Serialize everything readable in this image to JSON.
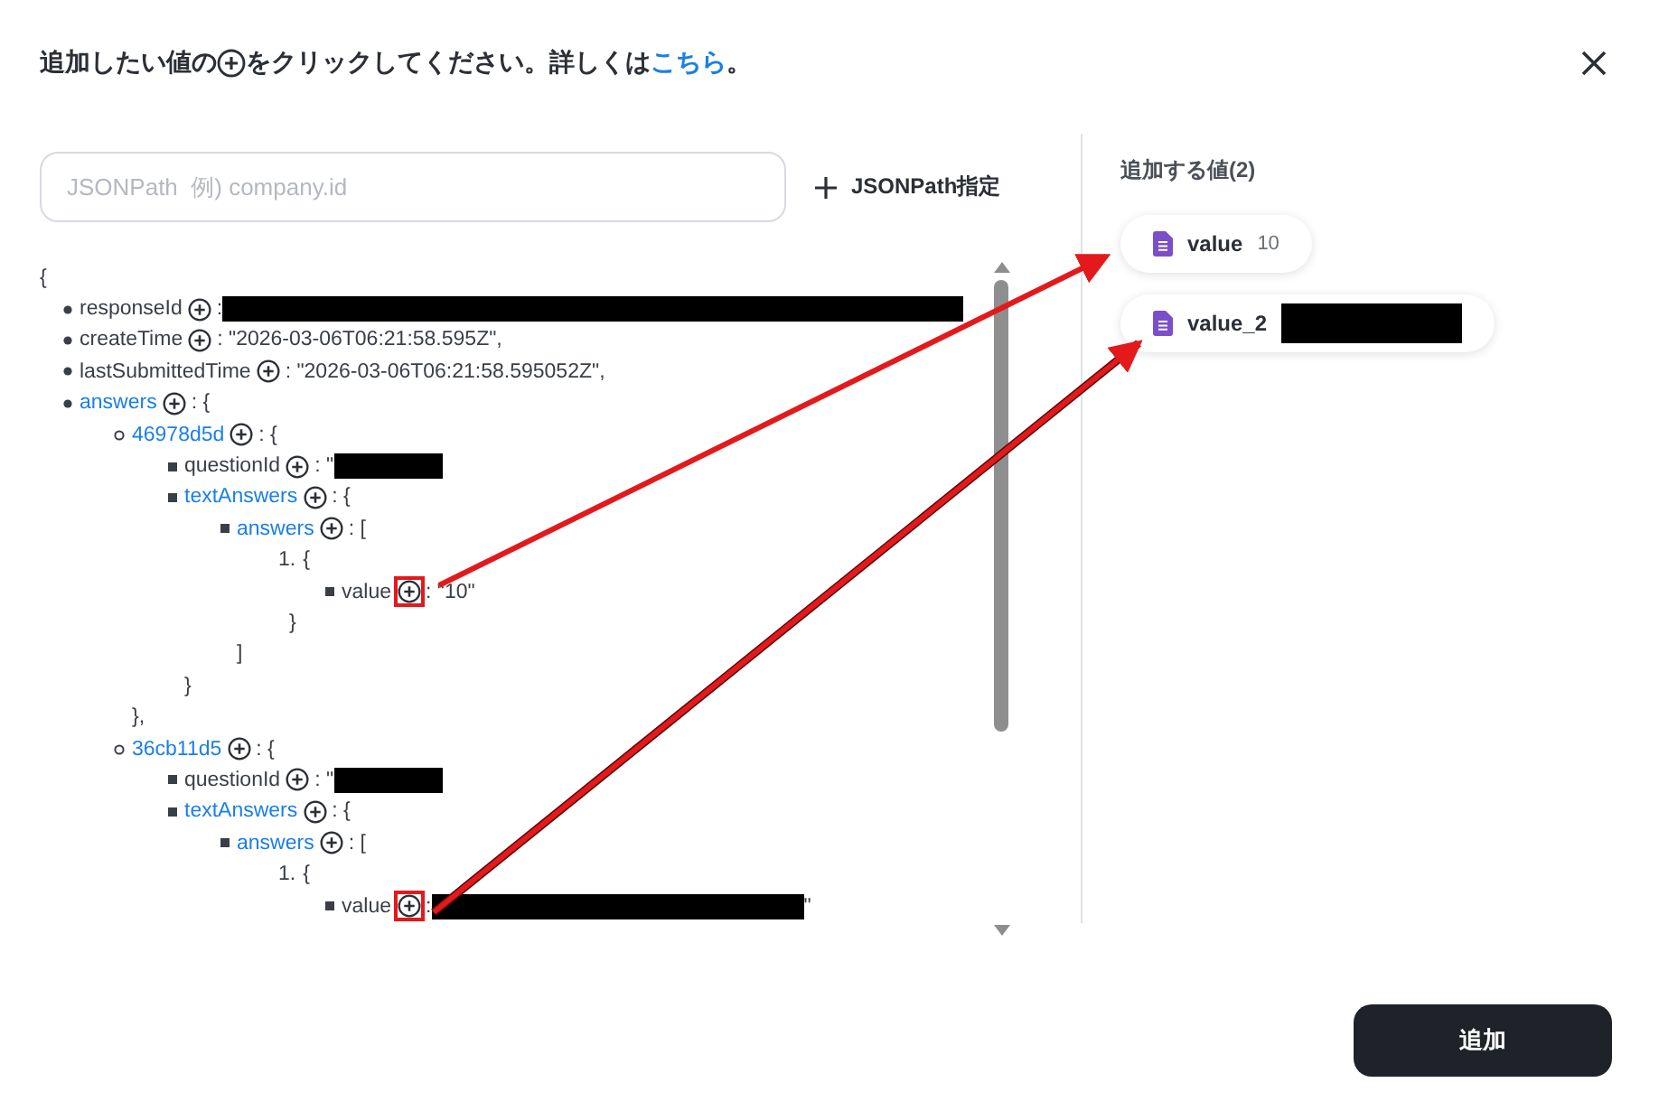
{
  "instruction": {
    "before": "追加したい値の",
    "after": "をクリックしてください。詳しくは",
    "link": "こちら",
    "end": "。"
  },
  "search": {
    "placeholder": "JSONPath  例) company.id"
  },
  "jsonpath_button": {
    "label": "JSONPath指定"
  },
  "tree": {
    "open": "{",
    "children": [
      {
        "key": "responseId",
        "link": false,
        "highlighted": false,
        "value": ":",
        "redacted": true
      },
      {
        "key": "createTime",
        "link": false,
        "highlighted": false,
        "value": ": \"2026-03-06T06:21:58.595Z\","
      },
      {
        "key": "lastSubmittedTime",
        "link": false,
        "highlighted": false,
        "value": ": \"2026-03-06T06:21:58.595052Z\","
      },
      {
        "key": "answers",
        "link": true,
        "highlighted": false,
        "value": ": {",
        "children": [
          {
            "key": "46978d5d",
            "link": true,
            "highlighted": false,
            "value": ": {",
            "close": "},",
            "children": [
              {
                "key": "questionId",
                "link": false,
                "highlighted": false,
                "value": ": \"",
                "redacted": true
              },
              {
                "key": "textAnswers",
                "link": true,
                "highlighted": false,
                "value": ": {",
                "close": "}",
                "children": [
                  {
                    "key": "answers",
                    "link": true,
                    "highlighted": false,
                    "value": ": [",
                    "close": "]",
                    "children": [
                      {
                        "marker": "1.",
                        "value": "{",
                        "close": "}",
                        "children": [
                          {
                            "key": "value",
                            "link": false,
                            "highlighted": true,
                            "value": ": \"10\""
                          }
                        ]
                      }
                    ]
                  }
                ]
              }
            ]
          },
          {
            "key": "36cb11d5",
            "link": true,
            "highlighted": false,
            "value": ": {",
            "children": [
              {
                "key": "questionId",
                "link": false,
                "highlighted": false,
                "value": ": \"",
                "redacted": true
              },
              {
                "key": "textAnswers",
                "link": true,
                "highlighted": false,
                "value": ": {",
                "children": [
                  {
                    "key": "answers",
                    "link": true,
                    "highlighted": false,
                    "value": ": [",
                    "children": [
                      {
                        "marker": "1.",
                        "value": "{",
                        "children": [
                          {
                            "key": "value",
                            "link": false,
                            "highlighted": true,
                            "value": ":",
                            "redacted": true,
                            "tail": "\""
                          }
                        ]
                      }
                    ]
                  }
                ]
              }
            ]
          }
        ]
      }
    ]
  },
  "selected_panel": {
    "title": "追加する値(2)",
    "items": [
      {
        "label": "value",
        "value": "10"
      },
      {
        "label": "value_2",
        "redacted": true
      }
    ]
  },
  "submit_button": {
    "label": "追加"
  }
}
